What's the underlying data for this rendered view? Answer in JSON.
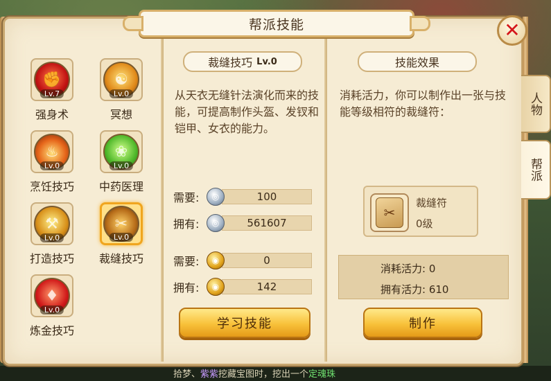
{
  "window": {
    "title": "帮派技能"
  },
  "side_tabs": [
    "人物",
    "帮派"
  ],
  "skills": [
    {
      "name": "强身术",
      "level": "Lv.7",
      "icon": "strength-icon"
    },
    {
      "name": "冥想",
      "level": "Lv.0",
      "icon": "meditation-icon"
    },
    {
      "name": "烹饪技巧",
      "level": "Lv.0",
      "icon": "cooking-icon"
    },
    {
      "name": "中药医理",
      "level": "Lv.0",
      "icon": "herbal-medicine-icon"
    },
    {
      "name": "打造技巧",
      "level": "Lv.0",
      "icon": "forging-icon"
    },
    {
      "name": "裁缝技巧",
      "level": "Lv.0",
      "icon": "tailoring-icon",
      "selected": true
    },
    {
      "name": "炼金技巧",
      "level": "Lv.0",
      "icon": "alchemy-icon"
    }
  ],
  "detail": {
    "title": "裁缝技巧",
    "level": "Lv.0",
    "description": "从天衣无缝针法演化而来的技能，可提高制作头盔、发钗和铠甲、女衣的能力。",
    "silver_need_label": "需要:",
    "silver_need": "100",
    "silver_have_label": "拥有:",
    "silver_have": "561607",
    "gold_need_label": "需要:",
    "gold_need": "0",
    "gold_have_label": "拥有:",
    "gold_have": "142",
    "learn_button": "学习技能"
  },
  "effect": {
    "title": "技能效果",
    "text": "消耗活力，你可以制作出一张与技能等级相符的裁缝符：",
    "item_name": "裁缝符",
    "item_level": "0级",
    "vitality_cost": "消耗活力: 0",
    "vitality_have": "拥有活力: 610",
    "craft_button": "制作"
  },
  "footer_text": {
    "a": "拾梦、",
    "b": "紫紫",
    "c": "挖藏宝图时，挖出一个",
    "d": "定魂珠"
  },
  "colors": {
    "accent_gold": "#f8c13a",
    "close_red": "#d4161a",
    "panel_bg": "#f6ecd4"
  }
}
